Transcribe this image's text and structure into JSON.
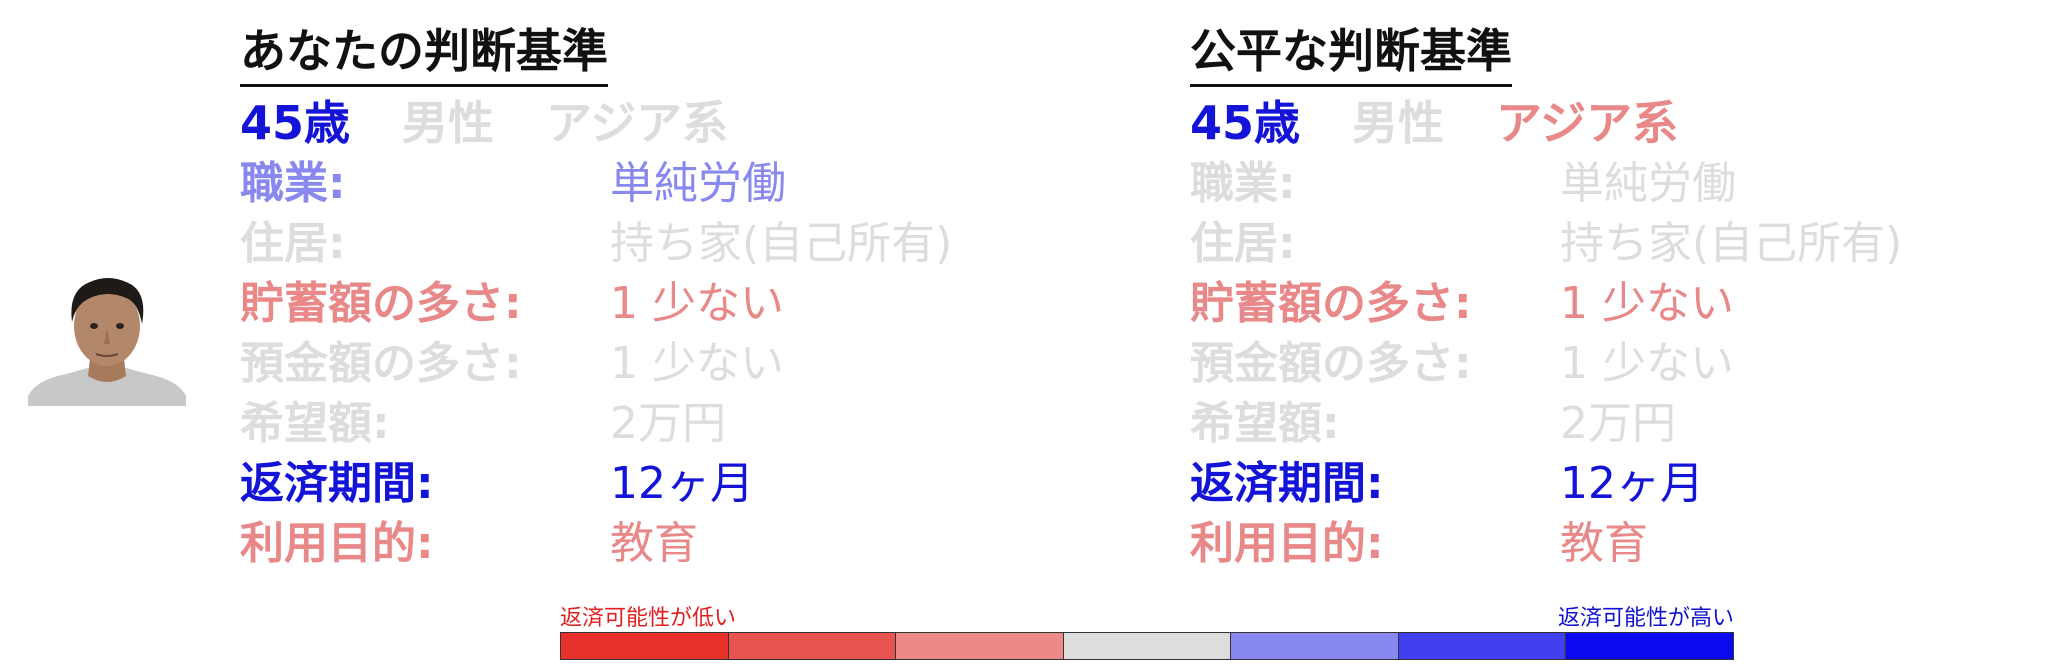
{
  "colors": {
    "blue_strong": "#1414d8",
    "blue_mid": "#8888ee",
    "red_mid": "#e88888",
    "gray": "#dddddd",
    "scale_low_text": "#e02020",
    "scale_high_text": "#1010d0"
  },
  "avatar": {
    "icon": "person-photo-icon"
  },
  "left": {
    "title": "あなたの判断基準",
    "demographics": [
      {
        "text": "45歳",
        "color": "#1414d8"
      },
      {
        "text": "男性",
        "color": "#dddddd"
      },
      {
        "text": "アジア系",
        "color": "#dddddd"
      }
    ],
    "rows": [
      {
        "label": "職業:",
        "value": "単純労働",
        "color": "#8888ee"
      },
      {
        "label": "住居:",
        "value": "持ち家(自己所有)",
        "color": "#dddddd"
      },
      {
        "label": "貯蓄額の多さ:",
        "value": "1 少ない",
        "color": "#e88888"
      },
      {
        "label": "預金額の多さ:",
        "value": "1 少ない",
        "color": "#dddddd"
      },
      {
        "label": "希望額:",
        "value": "2万円",
        "color": "#dddddd"
      },
      {
        "label": "返済期間:",
        "value": "12ヶ月",
        "color": "#1414d8"
      },
      {
        "label": "利用目的:",
        "value": "教育",
        "color": "#e88888"
      }
    ]
  },
  "right": {
    "title": "公平な判断基準",
    "demographics": [
      {
        "text": "45歳",
        "color": "#1414d8"
      },
      {
        "text": "男性",
        "color": "#dddddd"
      },
      {
        "text": "アジア系",
        "color": "#e88888"
      }
    ],
    "rows": [
      {
        "label": "職業:",
        "value": "単純労働",
        "color": "#dddddd"
      },
      {
        "label": "住居:",
        "value": "持ち家(自己所有)",
        "color": "#dddddd"
      },
      {
        "label": "貯蓄額の多さ:",
        "value": "1 少ない",
        "color": "#e88888"
      },
      {
        "label": "預金額の多さ:",
        "value": "1 少ない",
        "color": "#dddddd"
      },
      {
        "label": "希望額:",
        "value": "2万円",
        "color": "#dddddd"
      },
      {
        "label": "返済期間:",
        "value": "12ヶ月",
        "color": "#1414d8"
      },
      {
        "label": "利用目的:",
        "value": "教育",
        "color": "#e88888"
      }
    ]
  },
  "scale": {
    "low_label": "返済可能性が低い",
    "high_label": "返済可能性が高い",
    "segments": [
      "#e8302a",
      "#e85550",
      "#ec8a88",
      "#dddddd",
      "#8888f0",
      "#4040f0",
      "#0a0af0"
    ]
  }
}
